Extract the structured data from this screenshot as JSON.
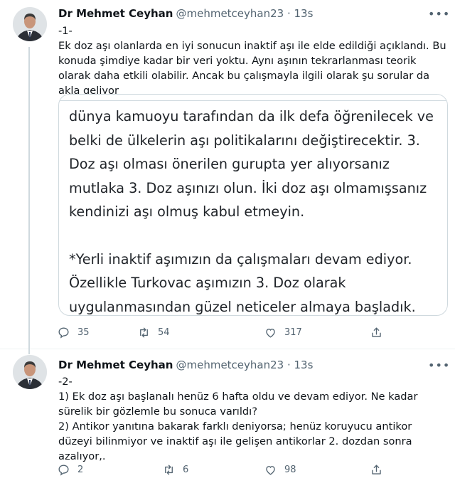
{
  "tweets": [
    {
      "author_name": "Dr Mehmet Ceyhan",
      "handle_time": "@mehmetceyhan23 · 13s",
      "text": "-1-\nEk doz aşı olanlarda en iyi sonucun inaktif aşı ile elde edildiği açıklandı. Bu konuda şimdiye kadar bir veri yoktu. Aynı aşının tekrarlanması teorik olarak daha etkili olabilir. Ancak bu çalışmayla ilgili olarak şu sorular da akla geliyor",
      "media_text": [
        "dünya kamuoyu tarafından da ilk defa öğrenilecek ve belki de ülkelerin aşı politikalarını değiştirecektir. 3. Doz aşı olması önerilen gurupta yer alıyorsanız mutlaka 3. Doz aşınızı olun. İki doz aşı olmamışsanız kendinizi aşı olmuş kabul etmeyin.",
        "*Yerli inaktif aşımızın da çalışmaları devam ediyor. Özellikle Turkovac aşımızın 3. Doz olarak uygulanmasından güzel neticeler almaya başladık."
      ],
      "replies": "35",
      "retweets": "54",
      "likes": "317"
    },
    {
      "author_name": "Dr Mehmet Ceyhan",
      "handle_time": "@mehmetceyhan23 · 13s",
      "text": "-2-\n1) Ek doz aşı başlanalı henüz 6 hafta oldu ve devam ediyor. Ne kadar sürelik bir gözlemle bu sonuca varıldı?\n2) Antikor yanıtına bakarak farklı deniyorsa; henüz koruyucu antikor düzeyi bilinmiyor ve inaktif aşı ile gelişen antikorlar 2. dozdan sonra azalıyor,.",
      "replies": "2",
      "retweets": "6",
      "likes": "98"
    }
  ],
  "colors": {
    "text": "#0f1419",
    "muted": "#536471",
    "border": "#cfd9de",
    "divider": "#eff3f4"
  },
  "icons": [
    "reply-icon",
    "retweet-icon",
    "like-icon",
    "share-icon",
    "more-icon"
  ]
}
